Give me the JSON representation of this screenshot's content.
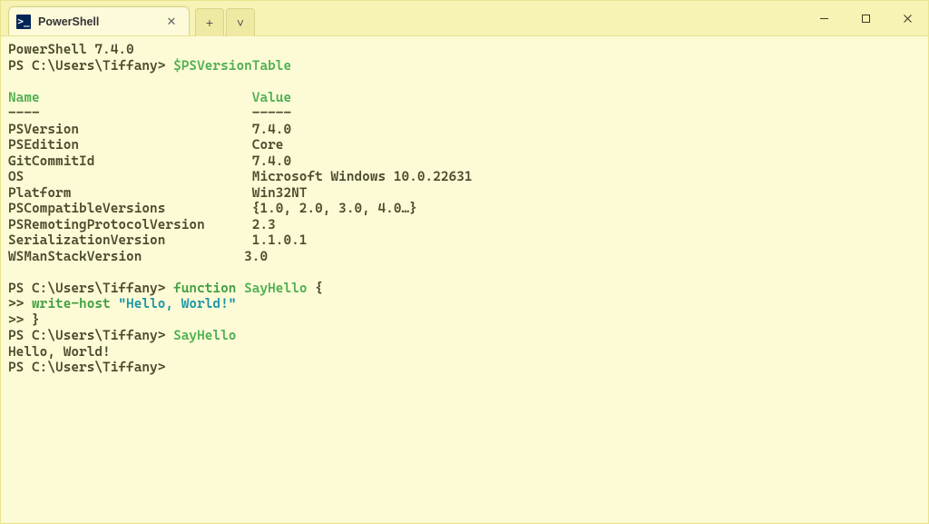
{
  "tab": {
    "title": "PowerShell",
    "icon_text": ">_"
  },
  "intro": {
    "line1": "PowerShell 7.4.0"
  },
  "prompt": "PS C:\\Users\\Tiffany>",
  "cmd1": "$PSVersionTable",
  "headers": {
    "name": "Name",
    "value": "Value",
    "dash": "----",
    "dash2": "-----"
  },
  "rows": [
    {
      "name": "PSVersion",
      "value": "7.4.0"
    },
    {
      "name": "PSEdition",
      "value": "Core"
    },
    {
      "name": "GitCommitId",
      "value": "7.4.0"
    },
    {
      "name": "OS",
      "value": "Microsoft Windows 10.0.22631"
    },
    {
      "name": "Platform",
      "value": "Win32NT"
    },
    {
      "name": "PSCompatibleVersions",
      "value": "{1.0, 2.0, 3.0, 4.0…}"
    },
    {
      "name": "PSRemotingProtocolVersion",
      "value": "2.3"
    },
    {
      "name": "SerializationVersion",
      "value": "1.1.0.1"
    },
    {
      "name": "WSManStackVersion",
      "value": "3.0"
    }
  ],
  "func": {
    "keyword": "function",
    "name": "SayHello",
    "open": "{",
    "cont": ">>",
    "cmdlet": "write-host",
    "string": "\"Hello, World!\"",
    "close": "}"
  },
  "call": "SayHello",
  "output": "Hello, World!",
  "glyphs": {
    "plus": "+",
    "chev": "˅",
    "close": "✕"
  }
}
